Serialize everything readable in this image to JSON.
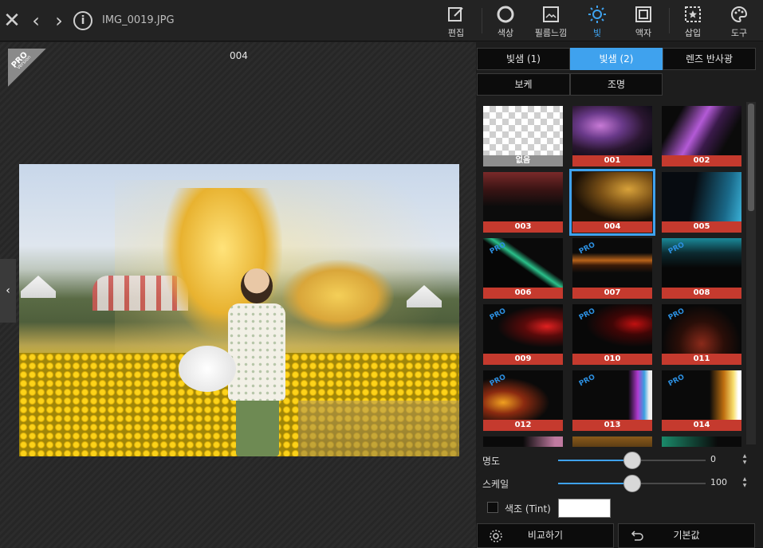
{
  "toolbar": {
    "filename": "IMG_0019.JPG",
    "tools": {
      "edit": "편집",
      "color": "색상",
      "feel": "필름느낌",
      "light": "빛",
      "frame": "액자",
      "insert": "삽입",
      "tools": "도구"
    },
    "active_tool": "light",
    "accent": "#3fa2ee"
  },
  "canvas": {
    "preset_label": "004",
    "pro_badge": "PRO",
    "pro_badge_sub": "Version"
  },
  "panel": {
    "tabs": {
      "leak1": "빛샘 (1)",
      "leak2": "빛샘 (2)",
      "lens_flare": "렌즈 반사광",
      "bokeh": "보케",
      "lighting": "조명"
    },
    "active_tab": "leak2",
    "thumbnails": [
      {
        "label": "없음",
        "pro": false
      },
      {
        "label": "001",
        "pro": false
      },
      {
        "label": "002",
        "pro": false
      },
      {
        "label": "003",
        "pro": false
      },
      {
        "label": "004",
        "pro": false,
        "selected": true
      },
      {
        "label": "005",
        "pro": false
      },
      {
        "label": "006",
        "pro": true
      },
      {
        "label": "007",
        "pro": true
      },
      {
        "label": "008",
        "pro": true
      },
      {
        "label": "009",
        "pro": true
      },
      {
        "label": "010",
        "pro": true
      },
      {
        "label": "011",
        "pro": true
      },
      {
        "label": "012",
        "pro": true
      },
      {
        "label": "013",
        "pro": true
      },
      {
        "label": "014",
        "pro": true
      }
    ],
    "pro_tag": "PRO",
    "brightness": {
      "label": "명도",
      "value": "0",
      "level": 0.5
    },
    "scale": {
      "label": "스케일",
      "value": "100",
      "level": 0.5
    },
    "tint": {
      "label": "색조 (Tint)",
      "color": "#ffffff",
      "checked": false
    },
    "compare_button": "비교하기",
    "reset_button": "기본값"
  }
}
